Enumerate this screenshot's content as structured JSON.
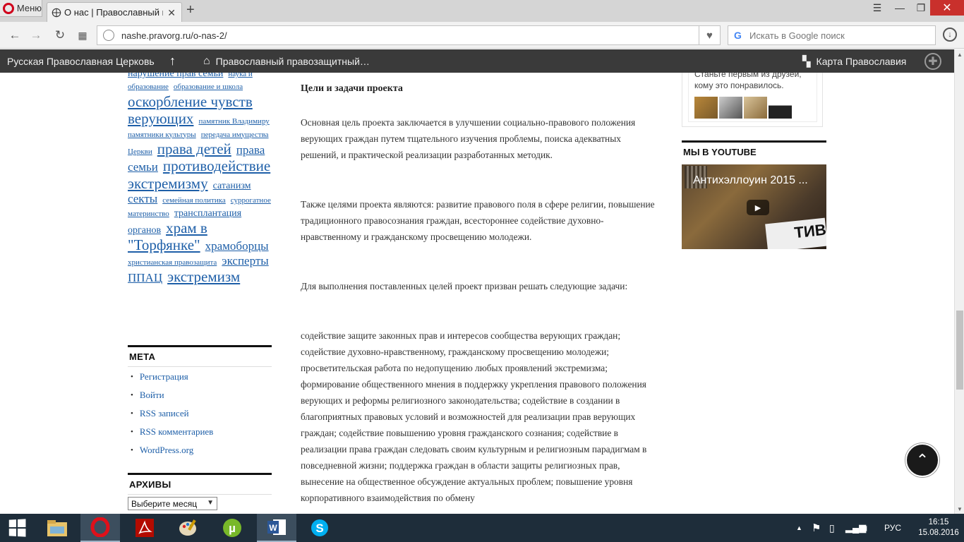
{
  "browser": {
    "menu_label": "Меню",
    "tab_title": "О нас | Православный пр",
    "new_tab_symbol": "+",
    "url": "nashe.pravorg.ru/o-nas-2/",
    "search_placeholder": "Искать в Google поиск"
  },
  "sitebar": {
    "left_link": "Русская Православная Церковь",
    "home_link": "Православный правозащитный…",
    "map_link": "Карта Православия"
  },
  "tagcloud": {
    "tags": [
      {
        "text": "нарушение прав семьи",
        "size": "m"
      },
      {
        "text": "наука и образование",
        "size": "s"
      },
      {
        "text": "образование и школа",
        "size": "s"
      },
      {
        "text": "оскорбление чувств верующих",
        "size": "xl"
      },
      {
        "text": "памятник Владимиру",
        "size": "s"
      },
      {
        "text": "памятники культуры",
        "size": "s"
      },
      {
        "text": "передача имущества Церкви",
        "size": "s"
      },
      {
        "text": "права детей",
        "size": "xl"
      },
      {
        "text": "права семьи",
        "size": "l"
      },
      {
        "text": "противодействие экстремизму",
        "size": "xl"
      },
      {
        "text": "сатанизм",
        "size": "m"
      },
      {
        "text": "секты",
        "size": "l"
      },
      {
        "text": "семейная политика",
        "size": "s"
      },
      {
        "text": "суррогатное материнство",
        "size": "s"
      },
      {
        "text": "трансплантация органов",
        "size": "m"
      },
      {
        "text": "храм в \"Торфянке\"",
        "size": "xl"
      },
      {
        "text": "храмоборцы",
        "size": "l"
      },
      {
        "text": "христианская правозащита",
        "size": "s"
      },
      {
        "text": "эксперты ППАЦ",
        "size": "l"
      },
      {
        "text": "экстремизм",
        "size": "xl"
      }
    ]
  },
  "meta": {
    "title": "МЕТА",
    "links": [
      "Регистрация",
      "Войти",
      "RSS записей",
      "RSS комментариев",
      "WordPress.org"
    ]
  },
  "archives": {
    "title": "АРХИВЫ",
    "select_value": "Выберите месяц"
  },
  "article": {
    "heading": "Цели и задачи проекта",
    "paragraphs": [
      "Основная цель проекта заключается в улучшении социально-правового положения верующих граждан путем тщательного изучения проблемы, поиска адекватных решений, и практической реализации разработанных методик.",
      "Также целями проекта являются: развитие правового поля в сфере религии, повышение традиционного правосознания граждан, всестороннее содействие духовно-нравственному и гражданскому просвещению молодежи.",
      "Для выполнения поставленных целей проект призван решать следующие задачи:",
      "содействие защите законных прав и интересов сообщества верующих граждан; содействие духовно-нравственному, гражданскому просвещению молодежи; просветительская работа по недопущению любых проявлений экстремизма; формирование общественного мнения в поддержку укрепления правового положения верующих и реформы религиозного законодательства; содействие в создании в благоприятных правовых условий и возможностей для реализации прав верующих граждан; содействие повышению уровня гражданского сознания; содействие в реализации права граждан следовать своим культурным и религиозным парадигмам в повседневной жизни; поддержка граждан в области защиты религиозных прав, вынесение на общественное обсуждение актуальных проблем; повышение уровня корпоративного взаимодействия по обмену"
    ]
  },
  "facebook": {
    "text": "Станьте первым из друзей, кому это понравилось."
  },
  "youtube": {
    "title": "МЫ В YOUTUBE",
    "video_title": "Антихэллоуин 2015 ...",
    "sign_text": "ТИВ"
  },
  "taskbar": {
    "language": "РУС",
    "time": "16:15",
    "date": "15.08.2016"
  },
  "colors": {
    "link": "#1e5fa8",
    "sitebar": "#3a3a3a",
    "taskbar": "#1e2d3a",
    "close_button": "#c9302c"
  }
}
